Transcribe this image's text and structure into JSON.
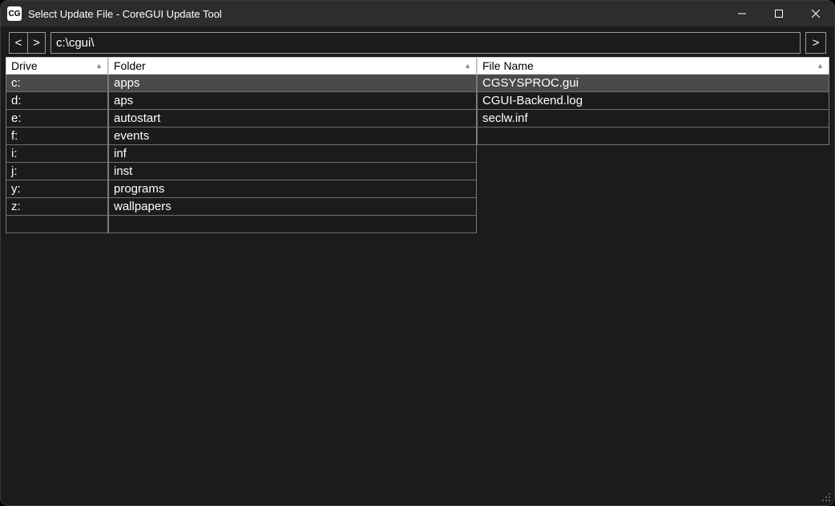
{
  "window": {
    "title": "Select Update File - CoreGUI Update Tool",
    "appicon_text": "CG"
  },
  "toolbar": {
    "back_glyph": "<",
    "fwd_glyph": ">",
    "go_glyph": ">",
    "path_value": "c:\\cgui\\"
  },
  "columns": {
    "drive": {
      "header": "Drive",
      "items": [
        "c:",
        "d:",
        "e:",
        "f:",
        "i:",
        "j:",
        "y:",
        "z:"
      ],
      "selected_index": 0,
      "trailing_empty_rows": 1
    },
    "folder": {
      "header": "Folder",
      "items": [
        "apps",
        "aps",
        "autostart",
        "events",
        "inf",
        "inst",
        "programs",
        "wallpapers"
      ],
      "selected_index": 0,
      "trailing_empty_rows": 1
    },
    "file": {
      "header": "File Name",
      "items": [
        "CGSYSPROC.gui",
        "CGUI-Backend.log",
        "seclw.inf"
      ],
      "selected_index": 0,
      "trailing_empty_rows": 1
    }
  },
  "sort_glyph": "▲"
}
